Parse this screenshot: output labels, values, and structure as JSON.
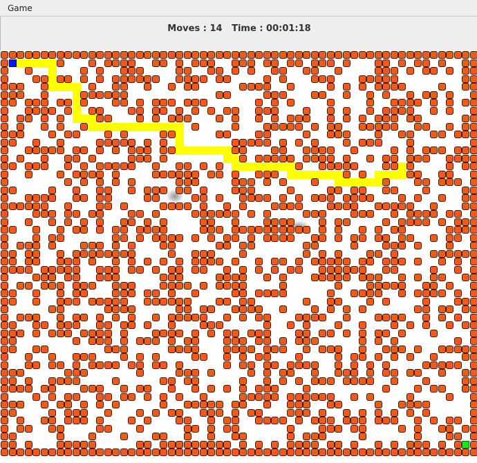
{
  "menu": {
    "game_label": "Game"
  },
  "status": {
    "moves_value": "14",
    "time_value": "00:01:18"
  },
  "maze": {
    "wall_color": "#f25a1a",
    "path_color": "#ffff00",
    "player_color": "#0018ff",
    "goal_color": "#11ee11",
    "player_icon": "blue-square",
    "goal_icon": "green-square"
  }
}
